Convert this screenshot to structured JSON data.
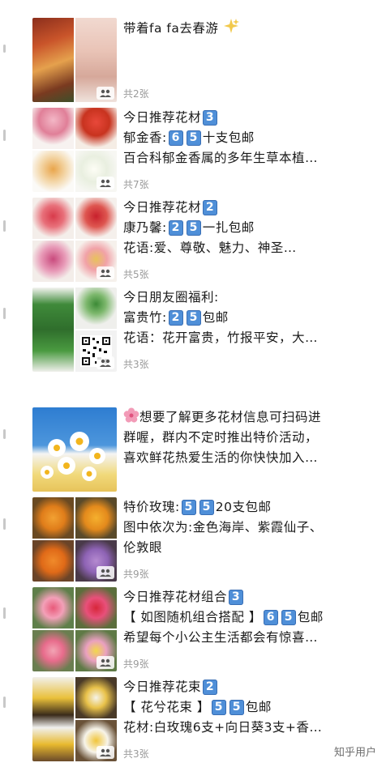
{
  "posts": [
    {
      "lines": [
        "带着fa fa去春游"
      ],
      "count": "共2张"
    },
    {
      "lines": [
        "今日推荐花材",
        "郁金香:",
        "百合科郁金香属的多年生草本植…"
      ],
      "nums": {
        "title": "3",
        "price": [
          "6",
          "5"
        ],
        "suffix": "十支包邮"
      },
      "count": "共7张"
    },
    {
      "lines": [
        "今日推荐花材",
        "康乃馨:",
        "花语:爱、尊敬、魅力、神圣…"
      ],
      "nums": {
        "title": "2",
        "price": [
          "2",
          "5"
        ],
        "suffix": "一扎包邮"
      },
      "count": "共5张"
    },
    {
      "lines": [
        "今日朋友圈福利:",
        "富贵竹:",
        "花语：花开富贵，竹报平安，大…"
      ],
      "nums": {
        "price": [
          "2",
          "5"
        ],
        "suffix": "包邮"
      },
      "count": "共3张"
    },
    {
      "lines": [
        "想要了解更多花材信息可扫码进",
        "群喔，群内不定时推出特价活动，",
        "喜欢鲜花热爱生活的你快快加入…"
      ]
    },
    {
      "lines": [
        "特价玫瑰:",
        "图中依次为:金色海岸、紫霞仙子、",
        "伦敦眼"
      ],
      "nums": {
        "price": [
          "5",
          "5"
        ],
        "suffix": "20支包邮"
      },
      "count": "共9张"
    },
    {
      "lines": [
        "今日推荐花材组合",
        "【 如图随机组合搭配 】",
        "希望每个小公主生活都会有惊喜…"
      ],
      "nums": {
        "title": "3",
        "price": [
          "6",
          "5"
        ],
        "suffix": "包邮"
      },
      "count": "共9张"
    },
    {
      "lines": [
        "今日推荐花束",
        "【 花兮花束 】",
        "花材:白玫瑰6支+向日葵3支+香…"
      ],
      "nums": {
        "title": "2",
        "price": [
          "5",
          "5"
        ],
        "suffix": "包邮"
      },
      "count": "共3张"
    }
  ],
  "watermark": "知乎用户",
  "colors": {
    "num_badge": "#4f8fd8",
    "count_text": "#9a9a9a"
  }
}
